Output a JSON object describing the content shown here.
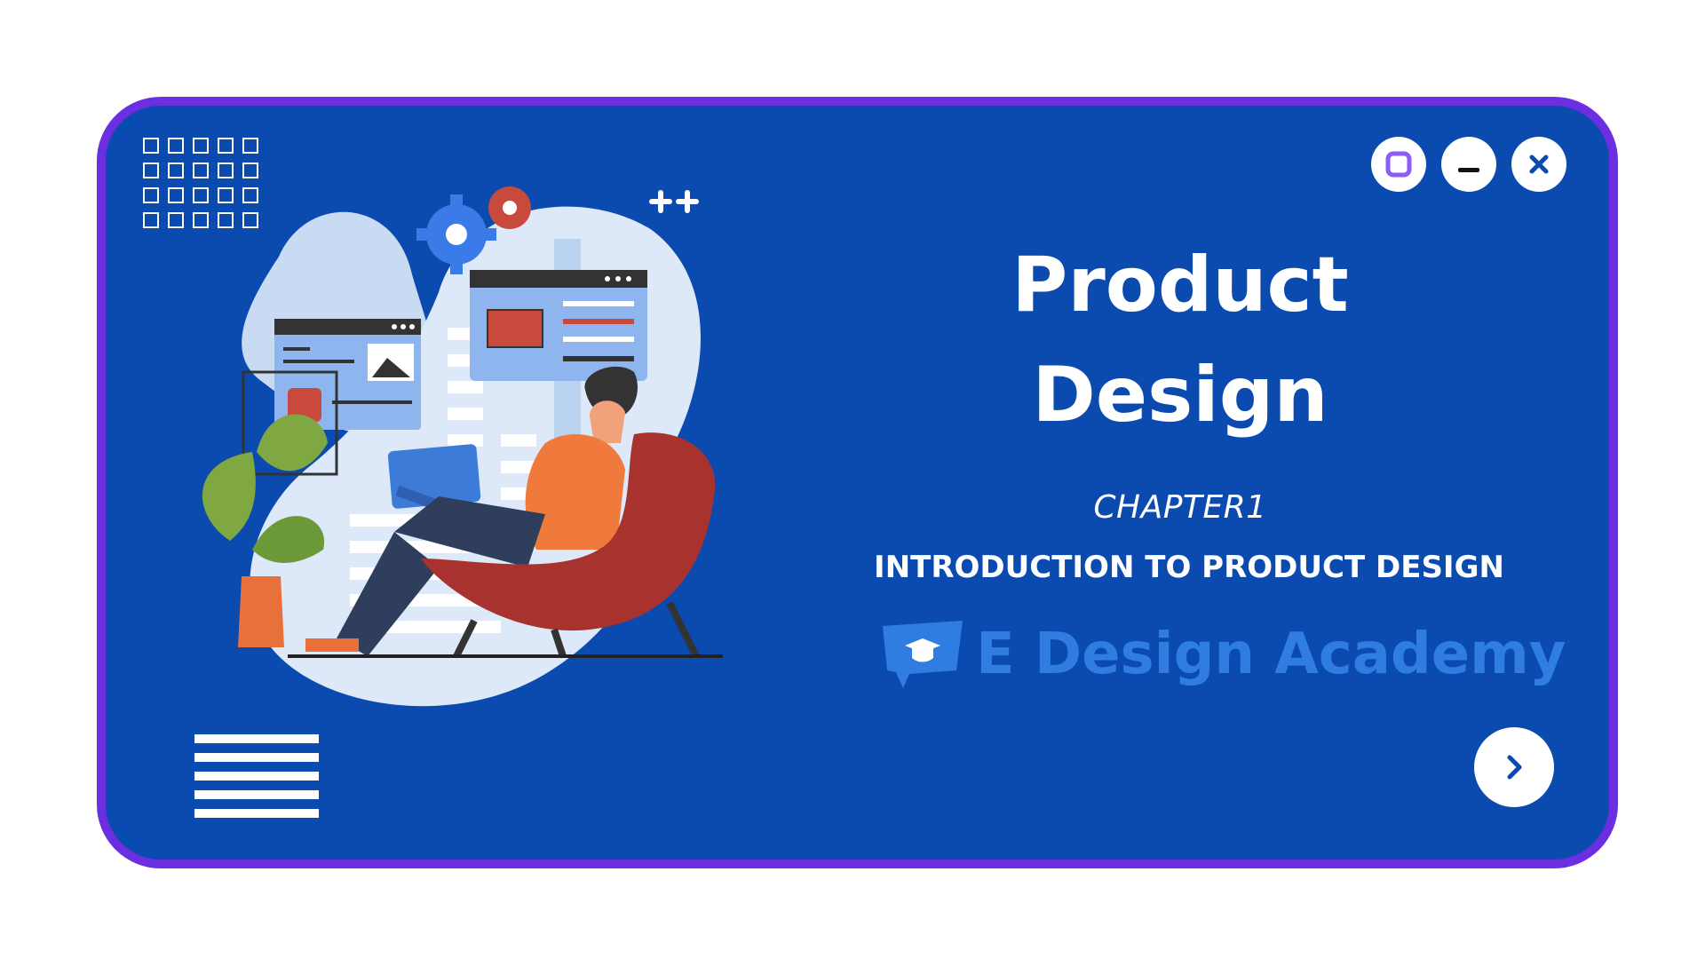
{
  "title": "Product\nDesign",
  "chapter": "CHAPTER1",
  "subtitle": "INTRODUCTION TO PRODUCT DESIGN",
  "brand": {
    "name": "E Design Academy",
    "icon": "graduation-cap-icon"
  },
  "window_controls": [
    {
      "icon": "maximize-icon"
    },
    {
      "icon": "minimize-icon"
    },
    {
      "icon": "close-icon"
    }
  ],
  "next_button": {
    "icon": "chevron-right-icon"
  },
  "colors": {
    "background": "#0b4bb0",
    "border": "#6b2ee0",
    "accent_purple": "#8b5cf6",
    "text": "#ffffff",
    "brand_text": "#2f7de0"
  }
}
